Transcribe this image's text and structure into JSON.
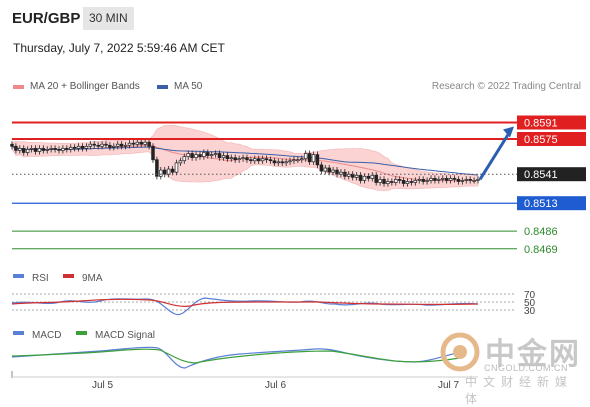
{
  "header": {
    "symbol": "EUR/GBP",
    "timeframe": "30 MIN",
    "timestamp": "Thursday, July 7, 2022 5:59:46 AM CET"
  },
  "legend": {
    "ma20": {
      "label": "MA 20 + Bollinger Bands",
      "color": "#f08a8a"
    },
    "ma50": {
      "label": "MA 50",
      "color": "#3a5fa8"
    }
  },
  "credit": "Research © 2022 Trading Central",
  "watermark": {
    "brand": "中金网",
    "url": "CNGOLD.COM.CN",
    "subtitle": "中文财经新媒体"
  },
  "colors": {
    "resistance": "#e02020",
    "pivot": "#1f5bd1",
    "support": "#2e8b2e",
    "current": "#222222",
    "candle": "#222222",
    "bollinger_fill": "#fbd3d3",
    "rsi": "#5a7fd6",
    "rsi_ma": "#d03030",
    "macd": "#5a7fd6",
    "macd_signal": "#3aa03a",
    "arrow": "#2a5fb0"
  },
  "chart_data": [
    {
      "type": "candlestick",
      "x_labels": [
        "Jul 5",
        "Jul 6",
        "Jul 7"
      ],
      "ylim": [
        0.8462,
        0.8605
      ],
      "close": [
        0.8568,
        0.8564,
        0.8566,
        0.8562,
        0.8565,
        0.8566,
        0.8563,
        0.8566,
        0.8564,
        0.8565,
        0.8566,
        0.8565,
        0.8564,
        0.8566,
        0.8565,
        0.8567,
        0.8566,
        0.8568,
        0.8566,
        0.8568,
        0.857,
        0.8569,
        0.8568,
        0.857,
        0.8569,
        0.8567,
        0.8568,
        0.857,
        0.8568,
        0.8569,
        0.8571,
        0.857,
        0.8572,
        0.857,
        0.8572,
        0.8568,
        0.8555,
        0.8539,
        0.8545,
        0.8541,
        0.8546,
        0.8543,
        0.8552,
        0.8554,
        0.8558,
        0.8561,
        0.8557,
        0.856,
        0.8558,
        0.8562,
        0.8559,
        0.856,
        0.8561,
        0.8557,
        0.8559,
        0.8556,
        0.8557,
        0.8555,
        0.8556,
        0.8557,
        0.8555,
        0.8554,
        0.8556,
        0.8554,
        0.8556,
        0.8555,
        0.8554,
        0.8552,
        0.8553,
        0.8552,
        0.8553,
        0.8554,
        0.8555,
        0.8555,
        0.8556,
        0.8561,
        0.8553,
        0.856,
        0.855,
        0.8544,
        0.8547,
        0.8543,
        0.8545,
        0.8541,
        0.8543,
        0.8539,
        0.8541,
        0.8538,
        0.854,
        0.8535,
        0.8539,
        0.8537,
        0.854,
        0.8533,
        0.8536,
        0.8532,
        0.8534,
        0.8533,
        0.8536,
        0.8535,
        0.8532,
        0.8534,
        0.8533,
        0.8535,
        0.8536,
        0.8534,
        0.8535,
        0.8537,
        0.8535,
        0.8536,
        0.8537,
        0.8535,
        0.8537,
        0.8536,
        0.8534,
        0.8535,
        0.8536,
        0.8535,
        0.8535,
        0.8536
      ]
    },
    {
      "type": "levels",
      "resistance": [
        0.8591,
        0.8575
      ],
      "current": 0.8541,
      "pivot": 0.8513,
      "support": [
        0.8486,
        0.8469
      ]
    },
    {
      "type": "line",
      "name": "RSI",
      "series": [
        {
          "name": "RSI"
        },
        {
          "name": "9MA"
        }
      ],
      "levels": [
        70,
        50,
        30
      ]
    },
    {
      "type": "line",
      "name": "MACD",
      "series": [
        {
          "name": "MACD"
        },
        {
          "name": "MACD Signal"
        }
      ]
    }
  ]
}
